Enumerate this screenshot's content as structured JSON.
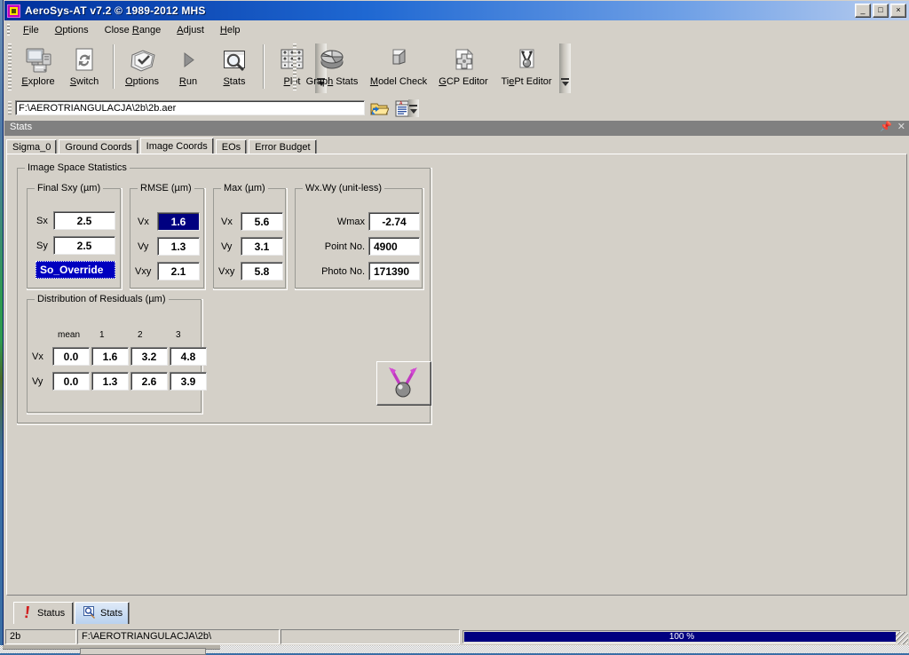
{
  "window": {
    "title": "AeroSys-AT  v7.2 © 1989-2012 MHS",
    "icon": "app-icon",
    "buttons": {
      "minimize": "_",
      "maximize": "□",
      "close": "×"
    }
  },
  "menu": {
    "items": [
      {
        "label": "File",
        "accel": "F"
      },
      {
        "label": "Options",
        "accel": "O"
      },
      {
        "label": "Close Range",
        "accel": "R"
      },
      {
        "label": "Adjust",
        "accel": "A"
      },
      {
        "label": "Help",
        "accel": "H"
      }
    ]
  },
  "toolbar": {
    "group1": [
      {
        "label": "Explore",
        "icon": "computer-explore-icon"
      },
      {
        "label": "Switch",
        "icon": "refresh-switch-icon"
      }
    ],
    "group2": [
      {
        "label": "Options",
        "icon": "checklist-options-icon"
      },
      {
        "label": "Run",
        "icon": "play-run-icon"
      },
      {
        "label": "Stats",
        "icon": "magnifier-stats-icon"
      }
    ],
    "group3": [
      {
        "label": "Plot",
        "icon": "grid-plot-icon"
      }
    ],
    "group4": [
      {
        "label": "Graph Stats",
        "icon": "pie-chart-icon"
      },
      {
        "label": "Model Check",
        "icon": "model-check-icon"
      },
      {
        "label": "GCP Editor",
        "icon": "crosshair-gcp-icon"
      },
      {
        "label": "TiePt Editor",
        "icon": "tiepoint-icon"
      }
    ],
    "overflow": "toolbar-overflow-chevron"
  },
  "path_bar": {
    "value": "F:\\AEROTRIANGULACJA\\2b\\2b.aer",
    "open_folder_icon": "open-folder-icon",
    "report_icon": "report-document-icon",
    "overflow": "path-overflow-chevron"
  },
  "panel": {
    "caption": "Stats",
    "pin_icon": "pin-icon",
    "close_icon": "close-icon",
    "tabs": [
      {
        "label": "Sigma_0",
        "active": false
      },
      {
        "label": "Ground Coords",
        "active": false
      },
      {
        "label": "Image Coords",
        "active": true
      },
      {
        "label": "EOs",
        "active": false
      },
      {
        "label": "Error Budget",
        "active": false
      }
    ]
  },
  "image_space_statistics": {
    "title": "Image Space Statistics",
    "final_sxy": {
      "title": "Final Sxy (µm)",
      "rows": [
        {
          "label": "Sx",
          "value": "2.5"
        },
        {
          "label": "Sy",
          "value": "2.5"
        }
      ],
      "override_label": "So_Override"
    },
    "rmse": {
      "title": "RMSE (µm)",
      "rows": [
        {
          "label": "Vx",
          "value": "1.6",
          "selected": true
        },
        {
          "label": "Vy",
          "value": "1.3",
          "selected": false
        },
        {
          "label": "Vxy",
          "value": "2.1",
          "selected": false
        }
      ]
    },
    "max": {
      "title": "Max (µm)",
      "rows": [
        {
          "label": "Vx",
          "value": "5.6"
        },
        {
          "label": "Vy",
          "value": "3.1"
        },
        {
          "label": "Vxy",
          "value": "5.8"
        }
      ]
    },
    "wxwy": {
      "title": "Wx.Wy (unit-less)",
      "rows": [
        {
          "label": "Wmax",
          "value": "-2.74"
        },
        {
          "label": "Point No.",
          "value": "4900"
        },
        {
          "label": "Photo No.",
          "value": "171390"
        }
      ]
    },
    "distribution": {
      "title": "Distribution of Residuals (µm)",
      "headers": [
        "mean",
        "1",
        "2",
        "3"
      ],
      "rows": [
        {
          "label": "Vx",
          "values": [
            "0.0",
            "1.6",
            "3.2",
            "4.8"
          ]
        },
        {
          "label": "Vy",
          "values": [
            "0.0",
            "1.3",
            "2.6",
            "3.9"
          ]
        }
      ]
    },
    "tiept_button_icon": "tiepoint-icon"
  },
  "bottom_tabs": [
    {
      "label": "Status",
      "icon": "exclamation-icon",
      "active": false
    },
    {
      "label": "Stats",
      "icon": "magnifier-stats-icon",
      "active": true
    }
  ],
  "status_bar": {
    "project": "2b",
    "path": "F:\\AEROTRIANGULACJA\\2b\\",
    "extra": "",
    "progress_label": "100 %",
    "progress_percent": 100
  },
  "colors": {
    "face": "#d4d0c8",
    "title_active": "#0a3c8c",
    "selection": "#000080",
    "progress": "#000080",
    "panel_caption": "#808080"
  }
}
